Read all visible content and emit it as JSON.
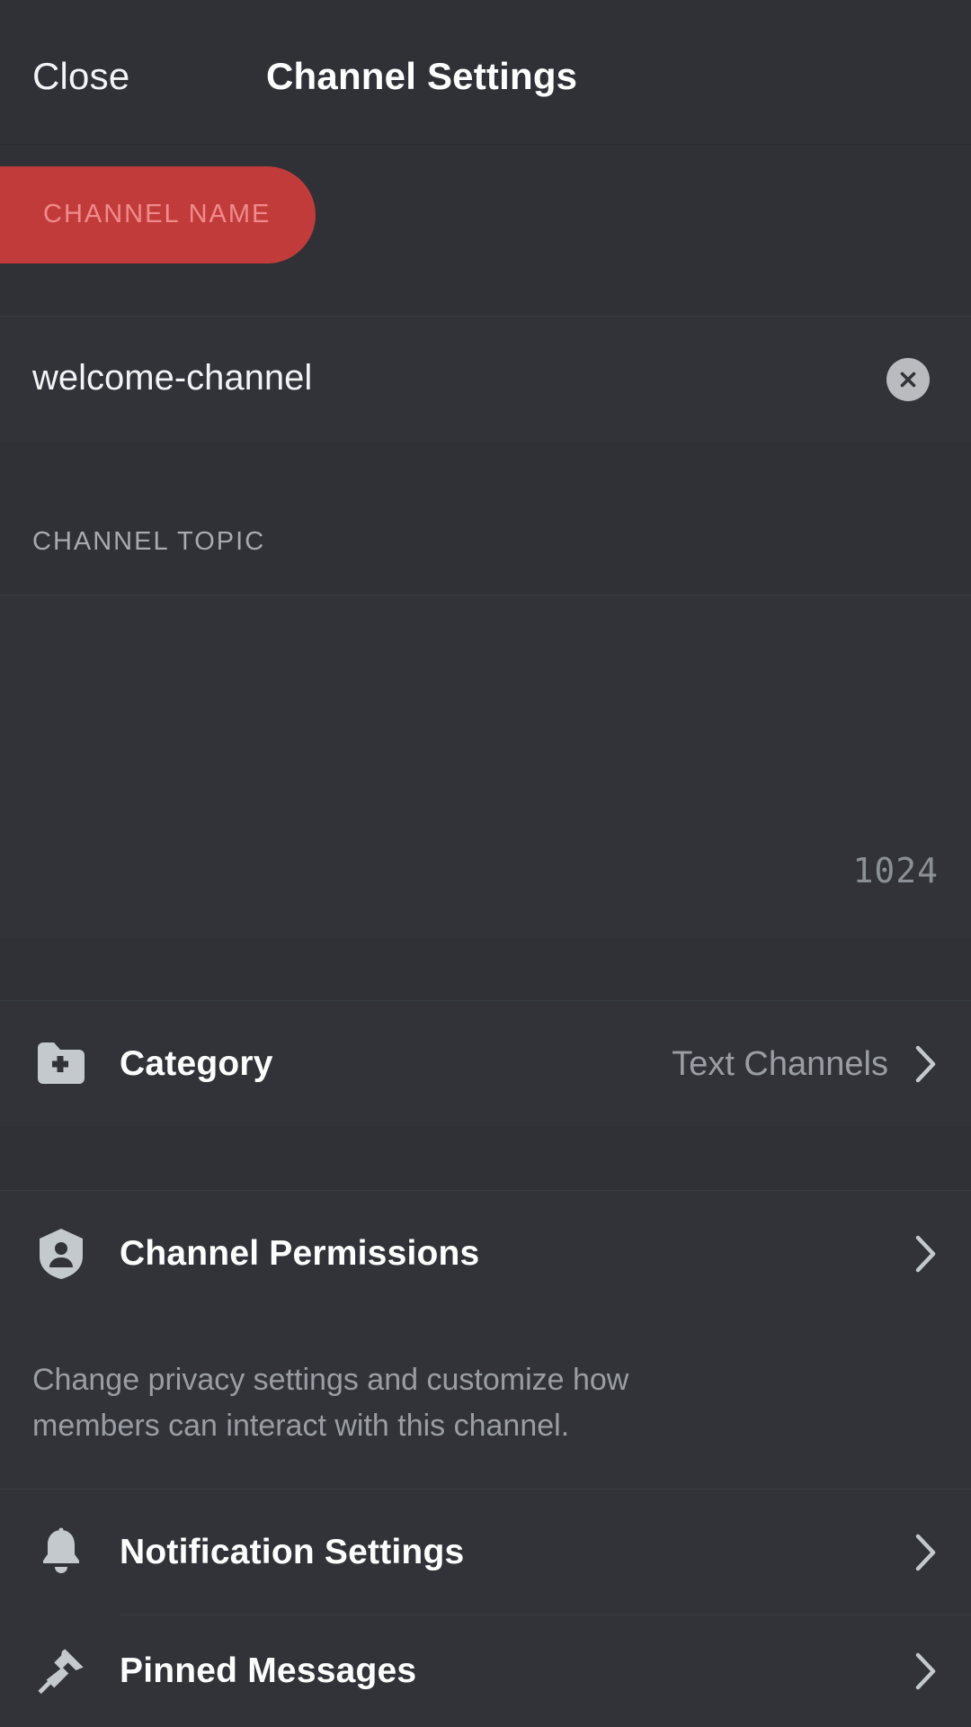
{
  "header": {
    "close_label": "Close",
    "title": "Channel Settings"
  },
  "channel_name_section": {
    "label": "CHANNEL NAME",
    "value": "welcome-channel",
    "clear_icon": "close-circle-icon",
    "highlight_color": "#c23b3b"
  },
  "channel_topic_section": {
    "label": "CHANNEL TOPIC",
    "value": "",
    "placeholder": "",
    "char_counter": "1024"
  },
  "rows": [
    {
      "name": "category",
      "icon": "folder-plus-icon",
      "label": "Category",
      "value": "Text Channels",
      "chevron": "chevron-right-icon"
    },
    {
      "name": "channel-permissions",
      "icon": "shield-person-icon",
      "label": "Channel Permissions",
      "value": "",
      "chevron": "chevron-right-icon",
      "description": "Change privacy settings and customize how members can interact with this channel."
    },
    {
      "name": "notification-settings",
      "icon": "bell-icon",
      "label": "Notification Settings",
      "value": "",
      "chevron": "chevron-right-icon"
    },
    {
      "name": "pinned-messages",
      "icon": "pin-icon",
      "label": "Pinned Messages",
      "value": "",
      "chevron": "chevron-right-icon"
    }
  ],
  "colors": {
    "background": "#2f3136",
    "surface": "#313338",
    "divider": "#3a3d43",
    "text_primary": "#ffffff",
    "text_secondary": "#9a9ea4",
    "icon": "#c4c9ce",
    "accent_highlight": "#c23b3b"
  }
}
